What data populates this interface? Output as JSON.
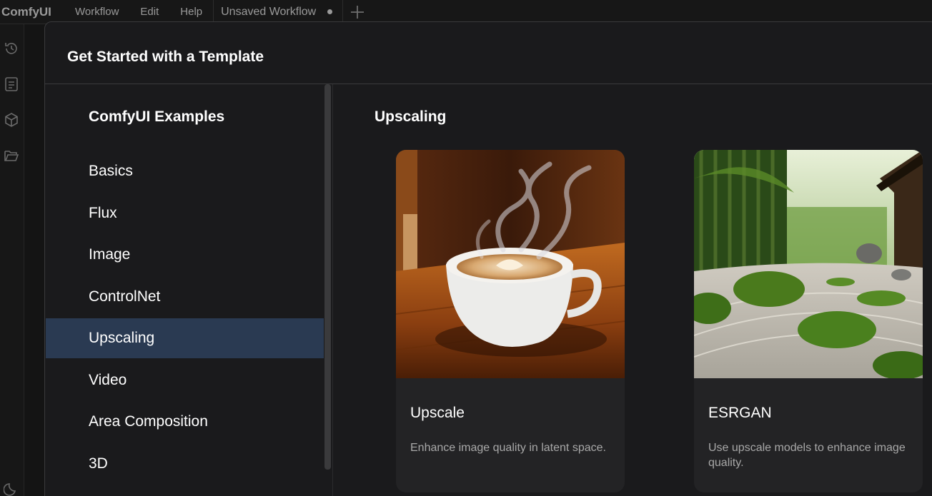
{
  "menubar": {
    "logo": "ComfyUI",
    "menus": [
      "Workflow",
      "Edit",
      "Help"
    ],
    "workflow_tab": {
      "title": "Unsaved Workflow",
      "unsaved_indicator": "●"
    }
  },
  "rail_icons": [
    "history-icon",
    "queue-icon",
    "model-library-icon",
    "folder-icon",
    "moon-icon"
  ],
  "dialog": {
    "title": "Get Started with a Template",
    "sidebar": {
      "heading": "ComfyUI Examples",
      "categories": [
        "Basics",
        "Flux",
        "Image",
        "ControlNet",
        "Upscaling",
        "Video",
        "Area Composition",
        "3D"
      ],
      "active_category": "Upscaling"
    },
    "content": {
      "heading": "Upscaling",
      "cards": [
        {
          "title": "Upscale",
          "description": "Enhance image quality in latent space.",
          "image": "latte-cup-with-steam"
        },
        {
          "title": "ESRGAN",
          "description": "Use upscale models to enhance image quality.",
          "image": "zen-garden-bamboo"
        }
      ]
    }
  },
  "colors": {
    "active_bg": "#2a3a52",
    "dialog_bg": "#1a1a1c",
    "card_bg": "#232325"
  }
}
